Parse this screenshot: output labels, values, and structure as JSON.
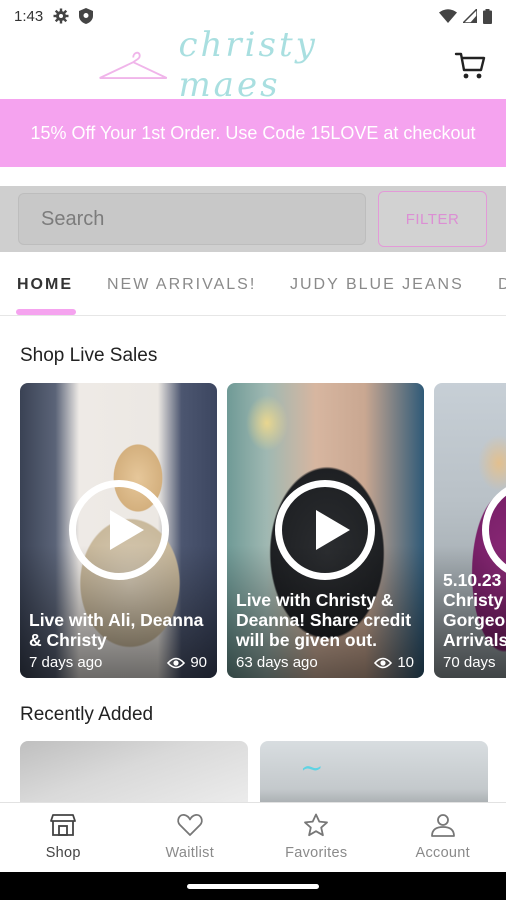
{
  "status_bar": {
    "time": "1:43"
  },
  "header": {
    "logo_text": "christy maes"
  },
  "promo": {
    "text": "15% Off Your 1st Order. Use Code 15LOVE  at checkout"
  },
  "search": {
    "placeholder": "Search",
    "filter_label": "FILTER"
  },
  "tabs": [
    {
      "label": "HOME",
      "active": true
    },
    {
      "label": "NEW ARRIVALS!"
    },
    {
      "label": "JUDY BLUE JEANS"
    },
    {
      "label": "D"
    }
  ],
  "live_sales": {
    "title": "Shop Live Sales",
    "cards": [
      {
        "title": "Live with Ali, Deanna & Christy",
        "age": "7 days ago",
        "views": "90"
      },
      {
        "title": "Live with Christy & Deanna!  Share credit will be given out.",
        "age": "63 days ago",
        "views": "10"
      },
      {
        "title": "5.10.23 Christy Gorgeo Arrivals",
        "age": "70 days",
        "views": ""
      }
    ]
  },
  "recently_added": {
    "title": "Recently Added"
  },
  "bottom_nav": [
    {
      "label": "Shop",
      "icon": "shop-icon",
      "active": true
    },
    {
      "label": "Waitlist",
      "icon": "heart-icon"
    },
    {
      "label": "Favorites",
      "icon": "star-icon"
    },
    {
      "label": "Account",
      "icon": "person-icon"
    }
  ],
  "colors": {
    "accent_pink": "#f5a3ef",
    "logo_teal": "#a9dfe0"
  }
}
